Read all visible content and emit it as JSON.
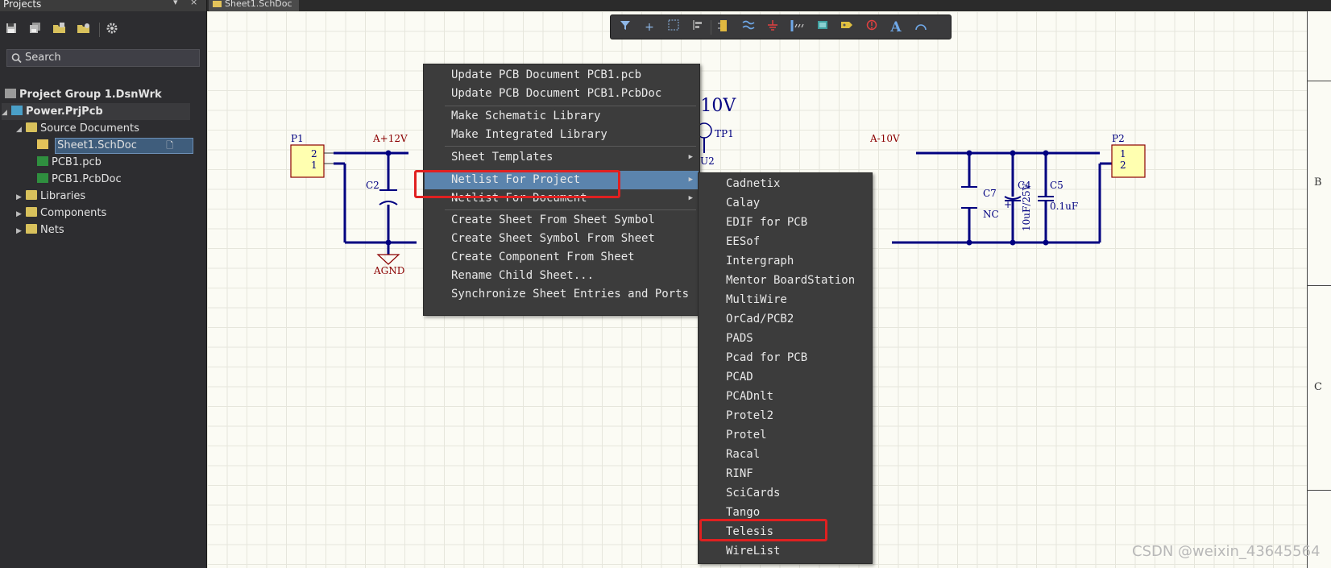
{
  "projects_panel": {
    "title": "Projects",
    "title_controls": [
      "▾",
      "×"
    ],
    "toolbar_icons": [
      "save-icon",
      "save-all-icon",
      "open-project-icon",
      "open-folder-icon",
      "settings-icon"
    ],
    "search_placeholder": "Search",
    "tree": [
      {
        "label": "Project Group 1.DsnWrk",
        "level": 0,
        "bold": true,
        "icon": "project-group-icon"
      },
      {
        "label": "Power.PrjPcb",
        "level": 0,
        "bold": true,
        "expanded": true,
        "icon": "pcb-project-icon"
      },
      {
        "label": "Source Documents",
        "level": 1,
        "expanded": true,
        "icon": "folder-icon"
      },
      {
        "label": "Sheet1.SchDoc",
        "level": 2,
        "selected": true,
        "icon": "schematic-doc-icon"
      },
      {
        "label": "PCB1.pcb",
        "level": 2,
        "icon": "pcb-doc-icon"
      },
      {
        "label": "PCB1.PcbDoc",
        "level": 2,
        "icon": "pcb-doc-icon"
      },
      {
        "label": "Libraries",
        "level": 1,
        "collapsed": true,
        "icon": "folder-icon"
      },
      {
        "label": "Components",
        "level": 1,
        "collapsed": true,
        "icon": "folder-icon"
      },
      {
        "label": "Nets",
        "level": 1,
        "collapsed": true,
        "icon": "folder-icon"
      }
    ]
  },
  "document_tab": {
    "label": "Sheet1.SchDoc"
  },
  "floating_toolbar": {
    "icons": [
      "filter-icon",
      "cross-probe-icon",
      "select-rect-icon",
      "align-icon",
      "place-part-icon",
      "wire-icon",
      "power-port-icon",
      "bus-icon",
      "harness-icon",
      "port-icon",
      "no-erc-icon",
      "text-icon",
      "arc-icon"
    ]
  },
  "context_menu": {
    "items": [
      {
        "label": "Update PCB Document PCB1.pcb"
      },
      {
        "label": "Update PCB Document PCB1.PcbDoc"
      },
      {
        "label": "Make Schematic Library"
      },
      {
        "label": "Make Integrated Library"
      },
      {
        "label": "Sheet Templates",
        "submenu": true
      },
      {
        "label": "Netlist For Project",
        "submenu": true,
        "highlighted": true
      },
      {
        "label": "Netlist For Document",
        "submenu": true
      },
      {
        "label": "Create Sheet From Sheet Symbol"
      },
      {
        "label": "Create Sheet Symbol From Sheet"
      },
      {
        "label": "Create Component From Sheet"
      },
      {
        "label": "Rename Child Sheet..."
      },
      {
        "label": "Synchronize Sheet Entries and Ports"
      }
    ]
  },
  "netlist_submenu": {
    "items": [
      "Cadnetix",
      "Calay",
      "EDIF for PCB",
      "EESof",
      "Intergraph",
      "Mentor BoardStation",
      "MultiWire",
      "OrCad/PCB2",
      "PADS",
      "Pcad for PCB",
      "PCAD",
      "PCADnlt",
      "Protel2",
      "Protel",
      "Racal",
      "RINF",
      "SciCards",
      "Tango",
      "Telesis",
      "WireList"
    ],
    "highlighted_box": "Telesis"
  },
  "schematic": {
    "labels": {
      "p1": "P1",
      "p1_pin_top": "2",
      "p1_pin_bot": "1",
      "p2": "P2",
      "p2_pin_top": "1",
      "p2_pin_bot": "2",
      "net_plus12": "A+12V",
      "net_minus10": "A-10V",
      "big_minus10": "-10V",
      "tp1": "TP1",
      "u2": "U2",
      "c2": "C2",
      "agnd": "AGND",
      "c7": "C7",
      "nc": "NC",
      "c4": "C4",
      "c4_val": "10uF/25V",
      "c5": "C5",
      "c5_val": "0.1uF",
      "plus": "+"
    },
    "zone_labels": [
      "B",
      "C"
    ],
    "wire_color": "#000080",
    "text_color": "#8b0000"
  },
  "watermark": "CSDN @weixin_43645564",
  "colors": {
    "menu_bg": "#3c3c3c",
    "menu_highlight": "#5b84ad",
    "callout_red": "#e02020",
    "canvas_bg": "#fbfbf4"
  }
}
